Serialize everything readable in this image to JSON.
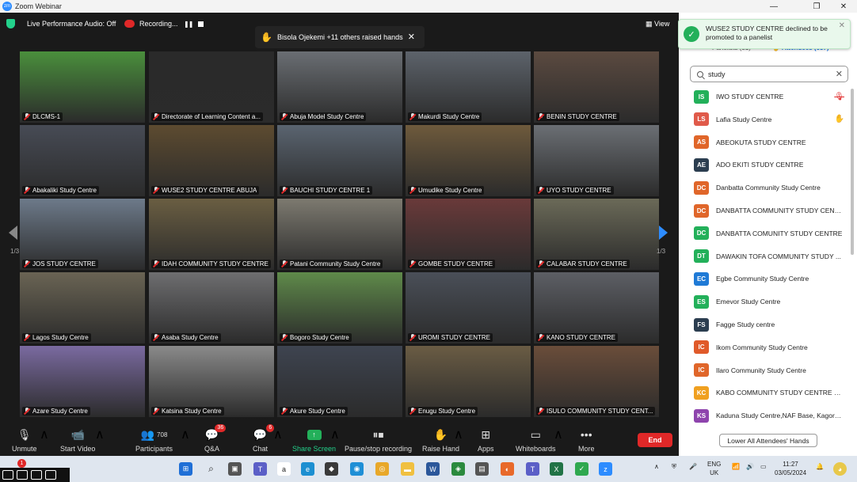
{
  "window": {
    "title": "Zoom Webinar",
    "app_icon": "zm",
    "minimize": "—",
    "maximize": "❐",
    "close": "✕"
  },
  "topbar": {
    "audio_status": "Live Performance Audio: Off",
    "recording_label": "Recording...",
    "pause_glyph": "❚❚",
    "raised_hands_text": "Bisola Ojekemi +11 others raised hands",
    "raised_close": "✕",
    "view_label": "View"
  },
  "grid": {
    "page_indicator": "1/3",
    "tiles": [
      {
        "name": "DLCMS-1",
        "bg": "#4a8f3c",
        "active": true
      },
      {
        "name": "Directorate of Learning Content a...",
        "bg": "#2a2a2a"
      },
      {
        "name": "Abuja Model Study Centre",
        "bg": "#6a6e73"
      },
      {
        "name": "Makurdi Study Centre",
        "bg": "#5d636b"
      },
      {
        "name": "BENIN STUDY CENTRE",
        "bg": "#5b4a40"
      },
      {
        "name": "Abakaliki Study Centre",
        "bg": "#474b55"
      },
      {
        "name": "WUSE2 STUDY CENTRE ABUJA",
        "bg": "#5d4b30"
      },
      {
        "name": "BAUCHI STUDY CENTRE 1",
        "bg": "#5a6470"
      },
      {
        "name": "Umudike Study Centre",
        "bg": "#6e5a3c"
      },
      {
        "name": "UYO STUDY CENTRE",
        "bg": "#6b6f74"
      },
      {
        "name": "JOS STUDY CENTRE",
        "bg": "#6d7a8a"
      },
      {
        "name": "IDAH COMMUNITY STUDY CENTRE",
        "bg": "#6a5e42"
      },
      {
        "name": "Patani Community Study Centre",
        "bg": "#7d7a70"
      },
      {
        "name": "GOMBE STUDY CENTRE",
        "bg": "#6a3a3a"
      },
      {
        "name": "CALABAR STUDY CENTRE",
        "bg": "#6b6a58"
      },
      {
        "name": "Lagos Study Centre",
        "bg": "#6a6454"
      },
      {
        "name": "Asaba Study Centre",
        "bg": "#6e6e70"
      },
      {
        "name": "Bogoro Study Centre",
        "bg": "#5f8a4a"
      },
      {
        "name": "UROMI STUDY CENTRE",
        "bg": "#4a4f58"
      },
      {
        "name": "KANO STUDY CENTRE",
        "bg": "#5d5f65"
      },
      {
        "name": "Azare Study Centre",
        "bg": "#7a6aa0"
      },
      {
        "name": "Katsina Study Centre",
        "bg": "#8a8a8a"
      },
      {
        "name": "Akure Study Centre",
        "bg": "#3e4450"
      },
      {
        "name": "Enugu Study Centre",
        "bg": "#6a5c44"
      },
      {
        "name": "ISULO COMMUNITY STUDY CENT...",
        "bg": "#6a4d3a"
      }
    ]
  },
  "toolbar": {
    "unmute": "Unmute",
    "start_video": "Start Video",
    "participants": "Participants",
    "participants_count": "708",
    "qa": "Q&A",
    "qa_badge": "36",
    "chat": "Chat",
    "chat_badge": "6",
    "share_screen": "Share Screen",
    "pause_recording": "Pause/stop recording",
    "raise_hand": "Raise Hand",
    "apps": "Apps",
    "whiteboards": "Whiteboards",
    "more": "More",
    "end": "End"
  },
  "toast": {
    "message": "WUSE2 STUDY CENTRE declined to be promoted to a panelist",
    "close": "✕"
  },
  "panel": {
    "tab_panelists": "Panelists (31)",
    "tab_attendees": "Attendees (657)",
    "search_value": "study",
    "clear_glyph": "✕",
    "lower_all": "Lower All Attendees' Hands",
    "attendees": [
      {
        "initials": "IS",
        "name": "IWO STUDY CENTRE",
        "color": "#23b05a",
        "status": "mic-off"
      },
      {
        "initials": "LS",
        "name": "Lafia Study Centre",
        "color": "#e05a4a",
        "status": "hand"
      },
      {
        "initials": "AS",
        "name": "ABEOKUTA STUDY CENTRE",
        "color": "#e0662a",
        "status": ""
      },
      {
        "initials": "AE",
        "name": "ADO EKITI STUDY CENTRE",
        "color": "#2c3e50",
        "status": ""
      },
      {
        "initials": "DC",
        "name": "Danbatta Community Study Centre",
        "color": "#e0662a",
        "status": ""
      },
      {
        "initials": "DC",
        "name": "DANBATTA COMMUNITY STUDY CENT...",
        "color": "#e0662a",
        "status": ""
      },
      {
        "initials": "DC",
        "name": "DANBATTA COMUNITY STUDY CENTRE",
        "color": "#23b05a",
        "status": ""
      },
      {
        "initials": "DT",
        "name": "DAWAKIN TOFA COMMUNITY STUDY ...",
        "color": "#23b05a",
        "status": ""
      },
      {
        "initials": "EC",
        "name": "Egbe Community Study Centre",
        "color": "#1f7ad6",
        "status": ""
      },
      {
        "initials": "ES",
        "name": "Emevor Study Centre",
        "color": "#23b05a",
        "status": ""
      },
      {
        "initials": "FS",
        "name": "Fagge Study centre",
        "color": "#2c3e50",
        "status": ""
      },
      {
        "initials": "IC",
        "name": "Ikom Community Study Centre",
        "color": "#e05a2a",
        "status": ""
      },
      {
        "initials": "IC",
        "name": "Ilaro Community Study Centre",
        "color": "#e0662a",
        "status": ""
      },
      {
        "initials": "KC",
        "name": "KABO COMMUNITY STUDY CENTRE K...",
        "color": "#f0a020",
        "status": ""
      },
      {
        "initials": "KS",
        "name": "Kaduna Study Centre,NAF Base, Kagoro...",
        "color": "#8e44ad",
        "status": ""
      }
    ]
  },
  "taskbar": {
    "lang_line1": "ENG",
    "lang_line2": "UK",
    "time": "11:27",
    "date": "03/05/2024",
    "notification_count": "1",
    "caret": "∧"
  }
}
